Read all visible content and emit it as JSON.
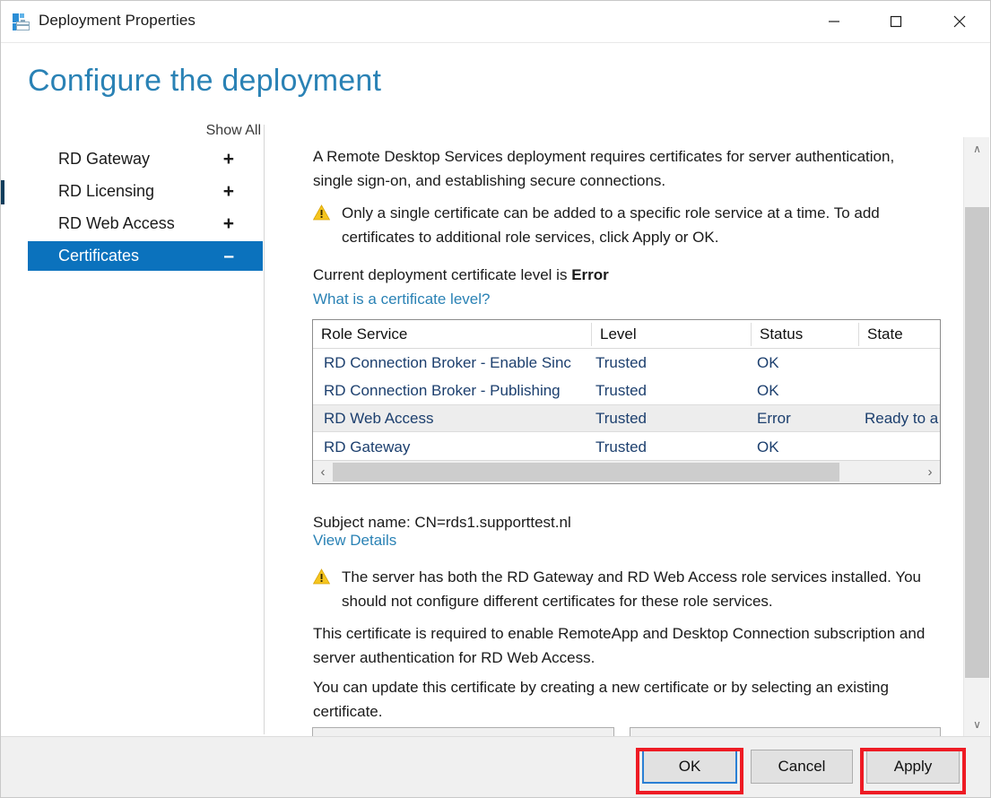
{
  "window": {
    "title": "Deployment Properties",
    "icon": "deployment-properties-icon",
    "minimize_label": "—",
    "maximize_label": "□",
    "close_label": "✕"
  },
  "heading": "Configure the deployment",
  "nav": {
    "show_all_label": "Show All",
    "items": [
      {
        "label": "RD Gateway",
        "sign": "+",
        "selected": false
      },
      {
        "label": "RD Licensing",
        "sign": "+",
        "selected": false
      },
      {
        "label": "RD Web Access",
        "sign": "+",
        "selected": false
      },
      {
        "label": "Certificates",
        "sign": "–",
        "selected": true
      }
    ]
  },
  "content": {
    "intro_paragraph": "A Remote Desktop Services deployment requires certificates for server authentication, single sign-on, and establishing secure connections.",
    "warning_1": "Only a single certificate can be added to a specific role service at a time. To add certificates to additional role services, click Apply or OK.",
    "cert_level_prefix": "Current deployment certificate level is ",
    "cert_level_value": "Error",
    "cert_level_link": "What is a certificate level?",
    "subject_name": "Subject name: CN=rds1.supporttest.nl",
    "view_details_link": "View Details",
    "warning_2": "The server has both the RD Gateway and RD Web Access role services installed. You should not configure different certificates for these role services.",
    "paragraph_2": "This certificate is required to enable RemoteApp and Desktop Connection subscription and server authentication for RD Web Access.",
    "paragraph_3": "You can update this certificate by creating a new certificate or by selecting an existing certificate."
  },
  "table": {
    "columns": [
      "Role Service",
      "Level",
      "Status",
      "State"
    ],
    "rows": [
      {
        "role": "RD Connection Broker - Enable Sinc",
        "level": "Trusted",
        "status": "OK",
        "state": "",
        "selected": false
      },
      {
        "role": "RD Connection Broker - Publishing",
        "level": "Trusted",
        "status": "OK",
        "state": "",
        "selected": false
      },
      {
        "role": "RD Web Access",
        "level": "Trusted",
        "status": "Error",
        "state": "Ready to a",
        "selected": true
      },
      {
        "role": "RD Gateway",
        "level": "Trusted",
        "status": "OK",
        "state": "",
        "selected": false
      }
    ],
    "scroll_left_label": "‹",
    "scroll_right_label": "›"
  },
  "scrollbar": {
    "up_label": "∧",
    "down_label": "∨"
  },
  "footer": {
    "ok_label": "OK",
    "cancel_label": "Cancel",
    "apply_label": "Apply"
  },
  "colors": {
    "accent_blue": "#0b72bd",
    "heading_blue": "#2a82b5",
    "link_blue": "#2a82b5",
    "warning_yellow": "#f5c51e",
    "annotation_red": "#ee1b24",
    "row_text_blue": "#1c3f6e"
  }
}
